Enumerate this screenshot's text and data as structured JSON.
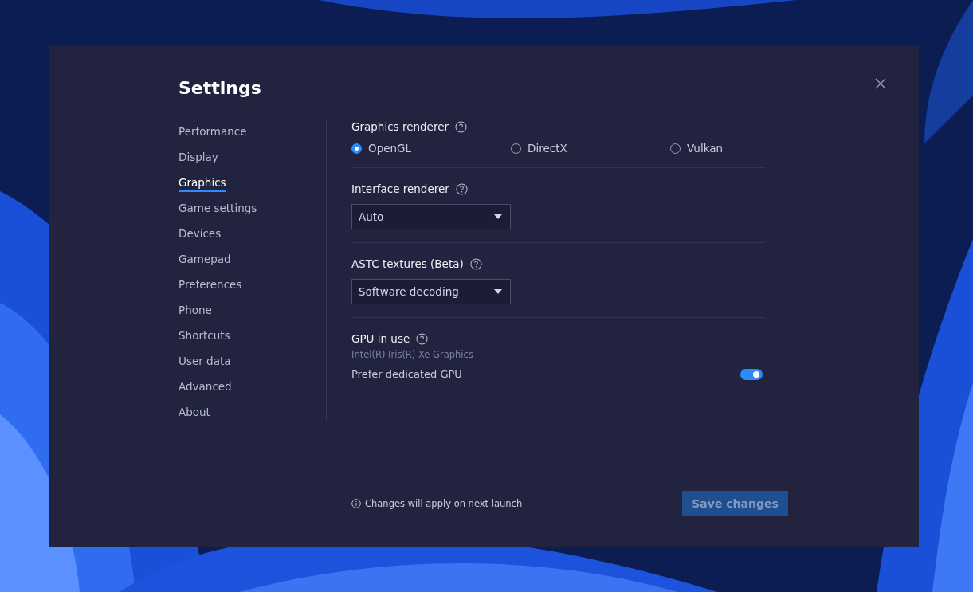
{
  "window": {
    "title": "Settings"
  },
  "sidebar": {
    "items": [
      {
        "label": "Performance",
        "selected": false
      },
      {
        "label": "Display",
        "selected": false
      },
      {
        "label": "Graphics",
        "selected": true
      },
      {
        "label": "Game settings",
        "selected": false
      },
      {
        "label": "Devices",
        "selected": false
      },
      {
        "label": "Gamepad",
        "selected": false
      },
      {
        "label": "Preferences",
        "selected": false
      },
      {
        "label": "Phone",
        "selected": false
      },
      {
        "label": "Shortcuts",
        "selected": false
      },
      {
        "label": "User data",
        "selected": false
      },
      {
        "label": "Advanced",
        "selected": false
      },
      {
        "label": "About",
        "selected": false
      }
    ]
  },
  "sections": [
    {
      "kind": "radio",
      "label": "Graphics renderer",
      "options": [
        {
          "label": "OpenGL",
          "selected": true
        },
        {
          "label": "DirectX",
          "selected": false
        },
        {
          "label": "Vulkan",
          "selected": false
        }
      ]
    },
    {
      "kind": "dropdown",
      "label": "Interface renderer",
      "value": "Auto"
    },
    {
      "kind": "dropdown",
      "label": "ASTC textures (Beta)",
      "value": "Software decoding"
    },
    {
      "kind": "gpu",
      "label": "GPU in use",
      "detail": "Intel(R) Iris(R) Xe Graphics",
      "toggle": {
        "label": "Prefer dedicated GPU",
        "on": true
      }
    }
  ],
  "footer": {
    "note": "Changes will apply on next launch",
    "button": {
      "label": "Save changes",
      "disabled": true
    }
  }
}
